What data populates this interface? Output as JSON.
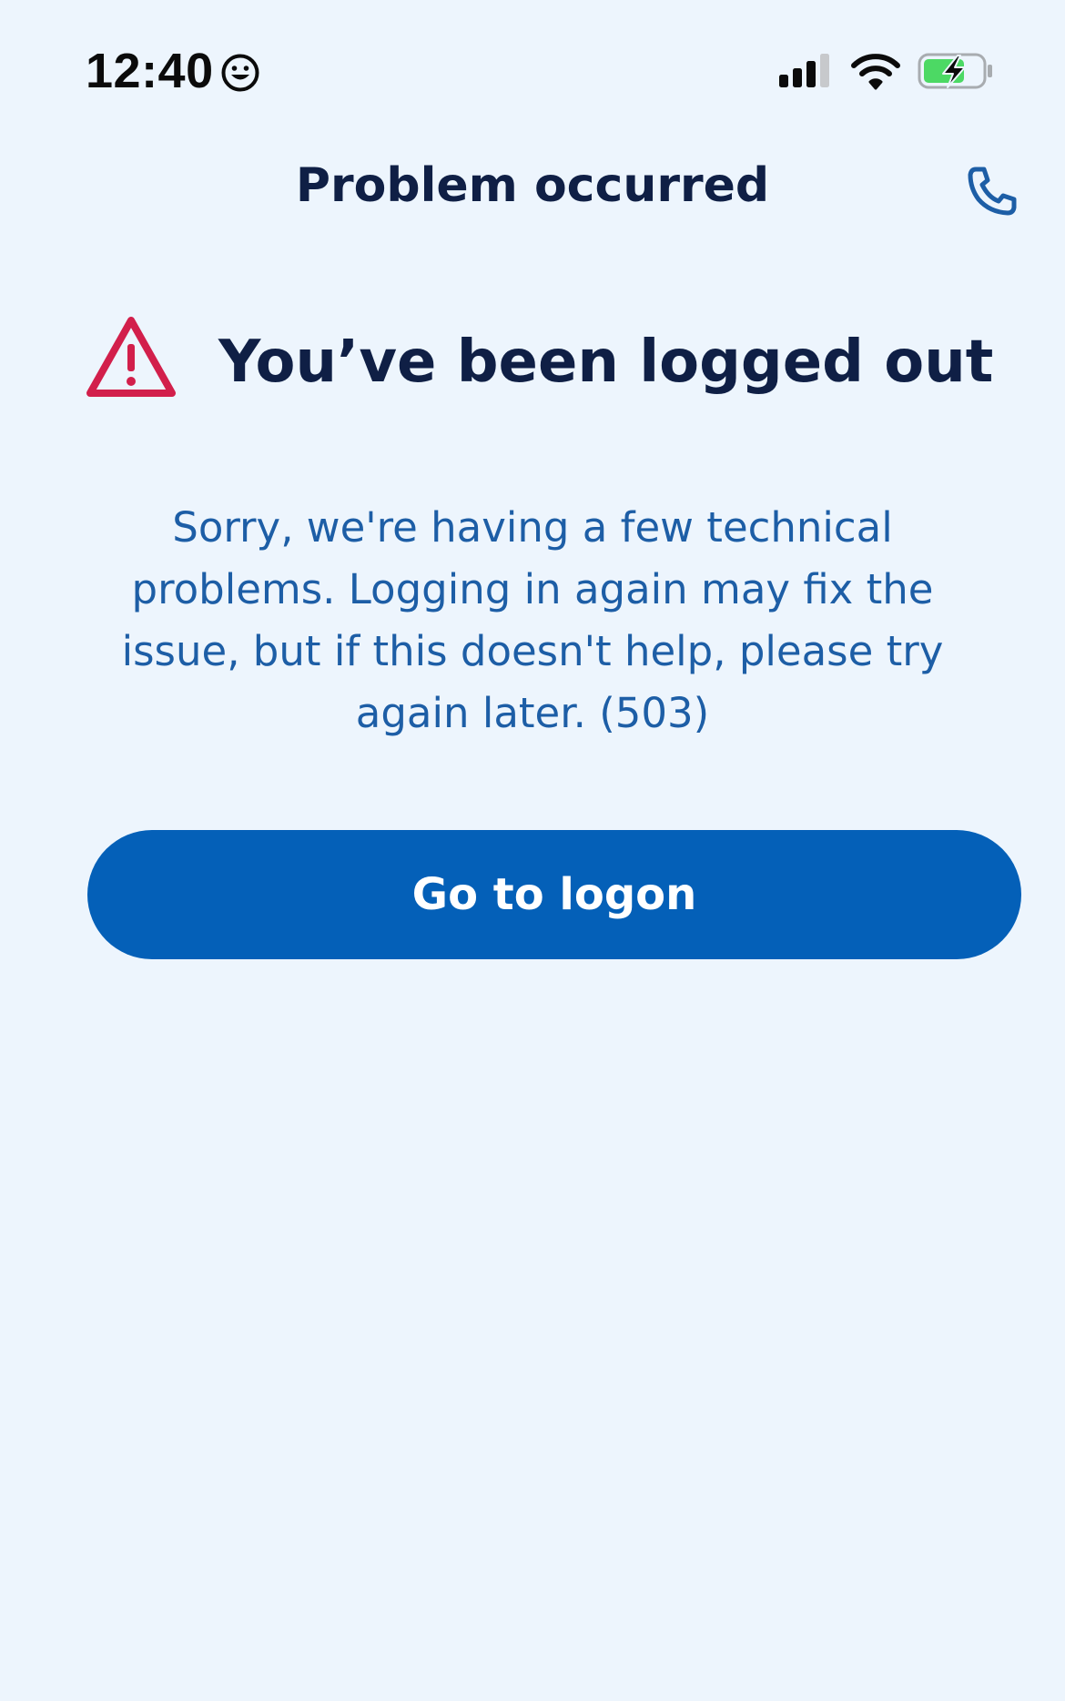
{
  "status_bar": {
    "time": "12:40",
    "icons": [
      "smiley-icon",
      "signal-icon",
      "wifi-icon",
      "battery-charging-icon"
    ]
  },
  "header": {
    "title": "Problem occurred",
    "call_icon": "phone-icon"
  },
  "error": {
    "icon": "warning-icon",
    "heading": "You’ve been logged out",
    "message": "Sorry, we're having a few technical problems. Logging in again may fix the issue, but if this doesn't help, please try again later. (503)"
  },
  "actions": {
    "logon_label": "Go to logon"
  },
  "colors": {
    "background": "#edf5fd",
    "heading": "#0f1f45",
    "body_text": "#1d5ea6",
    "button": "#0460b8",
    "warning": "#d21f4b",
    "battery_fill": "#4cd964"
  }
}
